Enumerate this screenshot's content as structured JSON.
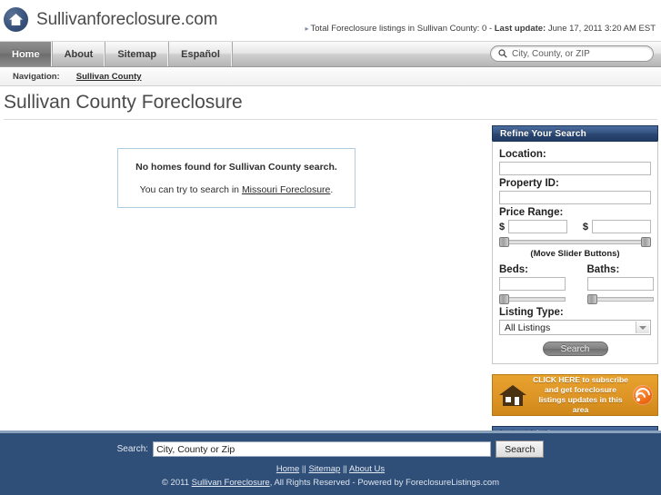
{
  "site": {
    "title": "Sullivanforeclosure.com",
    "logo_icon": "house-in-circle-icon"
  },
  "header": {
    "status_prefix_icon": "bullet-arrow-icon",
    "status_text_1": "Total Foreclosure listings in Sullivan County: 0 - ",
    "status_label_bold": "Last update:",
    "status_text_2": " June 17, 2011 3:20 AM EST",
    "search_placeholder": "City, County, or ZIP",
    "search_icon": "search-icon"
  },
  "nav": {
    "items": [
      {
        "label": "Home",
        "active": true
      },
      {
        "label": "About",
        "active": false
      },
      {
        "label": "Sitemap",
        "active": false
      },
      {
        "label": "Español",
        "active": false
      }
    ]
  },
  "breadcrumb": {
    "label": "Navigation:",
    "link": "Sullivan County"
  },
  "page": {
    "title": "Sullivan County Foreclosure"
  },
  "notice": {
    "title": "No homes found for Sullivan County search.",
    "sub_prefix": "You can try to search in ",
    "sub_link": "Missouri Foreclosure",
    "sub_suffix": "."
  },
  "sidebar": {
    "refine": {
      "heading": "Refine Your Search",
      "location_label": "Location:",
      "location_value": "",
      "location_placeholder": "",
      "property_id_label": "Property ID:",
      "property_id_value": "",
      "price_range_label": "Price Range:",
      "price_min_symbol": "$",
      "price_min_value": "",
      "price_max_symbol": "$",
      "price_max_value": "",
      "slider_hint": "(Move Slider Buttons)",
      "beds_label": "Beds:",
      "beds_value": "",
      "baths_label": "Baths:",
      "baths_value": "",
      "listing_type_label": "Listing Type:",
      "listing_type_selected": "All Listings",
      "listing_type_options": [
        "All Listings"
      ],
      "search_button": "Search",
      "dropdown_icon": "chevron-down-icon"
    },
    "subscribe": {
      "line1": "CLICK HERE to subscribe",
      "line2": "and get foreclosure",
      "line3": "listings updates in this area",
      "house_icon": "house-icon",
      "rss_icon": "rss-icon"
    },
    "latest": {
      "heading": "Latest Listings",
      "items": []
    }
  },
  "footer": {
    "search_label": "Search:",
    "search_value": "City, County or Zip",
    "search_button": "Search",
    "links": [
      {
        "label": "Home"
      },
      {
        "label": "Sitemap"
      },
      {
        "label": "About Us"
      }
    ],
    "link_separator": " || ",
    "copy_prefix": "© 2011 ",
    "copy_link": "Sullivan Foreclosure",
    "copy_suffix": ", All Rights Reserved - Powered by ForeclosureListings.com"
  },
  "colors": {
    "panel_header": "#2b4873",
    "footer_bg": "#2f4e78",
    "accent_orange": "#dd9526",
    "notice_border": "#aecde0"
  }
}
